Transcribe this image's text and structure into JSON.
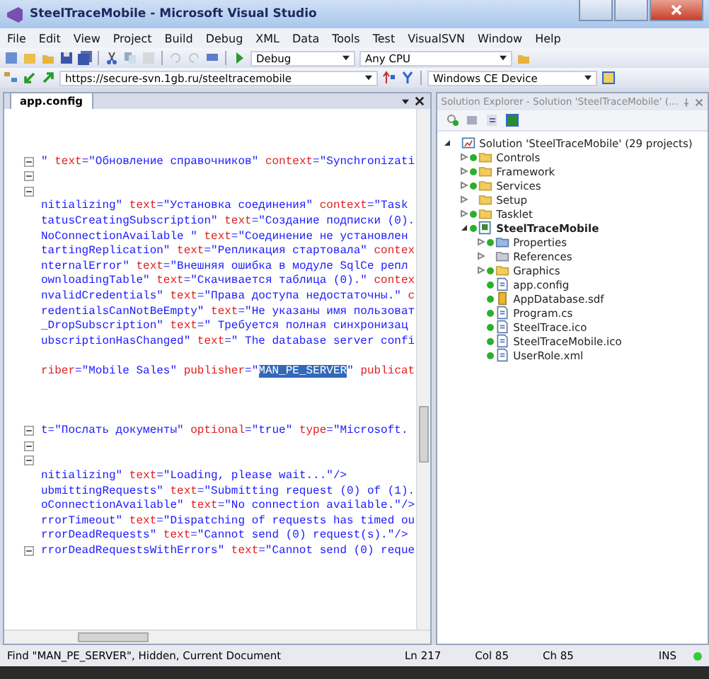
{
  "window": {
    "title": "SteelTraceMobile - Microsoft Visual Studio"
  },
  "menu": [
    "File",
    "Edit",
    "View",
    "Project",
    "Build",
    "Debug",
    "XML",
    "Data",
    "Tools",
    "Test",
    "VisualSVN",
    "Window",
    "Help"
  ],
  "toolbar": {
    "configuration": "Debug",
    "platform": "Any CPU",
    "repository_url": "https://secure-svn.1gb.ru/steeltracemobile",
    "device": "Windows CE Device"
  },
  "editor": {
    "tab": "app.config",
    "blocks": [
      [
        {
          "fold": true,
          "segments": [
            {
              "kind": "value",
              "text": "\" "
            },
            {
              "kind": "attr",
              "text": "text"
            },
            {
              "kind": "value",
              "text": "=\"Обновление справочников\" "
            },
            {
              "kind": "attr",
              "text": "context"
            },
            {
              "kind": "value",
              "text": "=\"Synchronizati"
            }
          ]
        },
        {
          "fold": true
        },
        {
          "fold": true
        },
        {
          "fold": false,
          "segments": [
            {
              "kind": "value",
              "text": "nitializing\" "
            },
            {
              "kind": "attr",
              "text": "text"
            },
            {
              "kind": "value",
              "text": "=\"Установка соединения\" "
            },
            {
              "kind": "attr",
              "text": "context"
            },
            {
              "kind": "value",
              "text": "=\"Task"
            }
          ]
        },
        {
          "fold": false,
          "segments": [
            {
              "kind": "value",
              "text": "tatusCreatingSubscription\" "
            },
            {
              "kind": "attr",
              "text": "text"
            },
            {
              "kind": "value",
              "text": "=\"Создание подписки (0)."
            }
          ]
        },
        {
          "fold": false,
          "segments": [
            {
              "kind": "value",
              "text": "NoConnectionAvailable \" "
            },
            {
              "kind": "attr",
              "text": "text"
            },
            {
              "kind": "value",
              "text": "=\"Соединение не установлен"
            }
          ]
        },
        {
          "fold": false,
          "segments": [
            {
              "kind": "value",
              "text": "tartingReplication\" "
            },
            {
              "kind": "attr",
              "text": "text"
            },
            {
              "kind": "value",
              "text": "=\"Репликация стартовала\" "
            },
            {
              "kind": "attr",
              "text": "contex"
            }
          ]
        },
        {
          "fold": false,
          "segments": [
            {
              "kind": "value",
              "text": "nternalError\" "
            },
            {
              "kind": "attr",
              "text": "text"
            },
            {
              "kind": "value",
              "text": "=\"Внешняя ошибка в модуле SqlCe репл"
            }
          ]
        },
        {
          "fold": false,
          "segments": [
            {
              "kind": "value",
              "text": "ownloadingTable\" "
            },
            {
              "kind": "attr",
              "text": "text"
            },
            {
              "kind": "value",
              "text": "=\"Скачивается таблица (0).\" "
            },
            {
              "kind": "attr",
              "text": "contex"
            }
          ]
        },
        {
          "fold": false,
          "segments": [
            {
              "kind": "value",
              "text": "nvalidCredentials\" "
            },
            {
              "kind": "attr",
              "text": "text"
            },
            {
              "kind": "value",
              "text": "=\"Права доступа недостаточны.\" "
            },
            {
              "kind": "attr",
              "text": "c"
            }
          ]
        },
        {
          "fold": false,
          "segments": [
            {
              "kind": "value",
              "text": "redentialsCanNotBeEmpty\" "
            },
            {
              "kind": "attr",
              "text": "text"
            },
            {
              "kind": "value",
              "text": "=\"Не указаны имя пользоват"
            }
          ]
        },
        {
          "fold": false,
          "segments": [
            {
              "kind": "value",
              "text": "_DropSubscription\" "
            },
            {
              "kind": "attr",
              "text": "text"
            },
            {
              "kind": "value",
              "text": "=\" Требуется полная синхронизац"
            }
          ]
        },
        {
          "fold": false,
          "segments": [
            {
              "kind": "value",
              "text": "ubscriptionHasChanged\" "
            },
            {
              "kind": "attr",
              "text": "text"
            },
            {
              "kind": "value",
              "text": "=\" The database server confi"
            }
          ]
        }
      ],
      [
        {
          "fold": false,
          "segments": [
            {
              "kind": "attr",
              "text": "riber"
            },
            {
              "kind": "value",
              "text": "=\"Mobile Sales\" "
            },
            {
              "kind": "attr",
              "text": "publisher"
            },
            {
              "kind": "value",
              "text": "=\""
            },
            {
              "kind": "selected",
              "text": "MAN_PE_SERVER"
            },
            {
              "kind": "value",
              "text": "\" "
            },
            {
              "kind": "attr",
              "text": "publicat"
            }
          ]
        }
      ],
      [
        {
          "fold": true,
          "segments": [
            {
              "kind": "value",
              "text": "t=\"Послать документы\" "
            },
            {
              "kind": "attr",
              "text": "optional"
            },
            {
              "kind": "value",
              "text": "=\"true\" "
            },
            {
              "kind": "attr",
              "text": "type"
            },
            {
              "kind": "value",
              "text": "=\"Microsoft."
            }
          ]
        },
        {
          "fold": true
        },
        {
          "fold": true
        },
        {
          "fold": false,
          "segments": [
            {
              "kind": "value",
              "text": "nitializing\" "
            },
            {
              "kind": "attr",
              "text": "text"
            },
            {
              "kind": "value",
              "text": "=\"Loading, please wait...\"/>"
            }
          ]
        },
        {
          "fold": false,
          "segments": [
            {
              "kind": "value",
              "text": "ubmittingRequests\" "
            },
            {
              "kind": "attr",
              "text": "text"
            },
            {
              "kind": "value",
              "text": "=\"Submitting request (0) of (1)."
            }
          ]
        },
        {
          "fold": false,
          "segments": [
            {
              "kind": "value",
              "text": "oConnectionAvailable\" "
            },
            {
              "kind": "attr",
              "text": "text"
            },
            {
              "kind": "value",
              "text": "=\"No connection available.\"/>"
            }
          ]
        },
        {
          "fold": false,
          "segments": [
            {
              "kind": "value",
              "text": "rrorTimeout\" "
            },
            {
              "kind": "attr",
              "text": "text"
            },
            {
              "kind": "value",
              "text": "=\"Dispatching of requests has timed ou"
            }
          ]
        },
        {
          "fold": false,
          "segments": [
            {
              "kind": "value",
              "text": "rrorDeadRequests\" "
            },
            {
              "kind": "attr",
              "text": "text"
            },
            {
              "kind": "value",
              "text": "=\"Cannot send (0) request(s).\"/>"
            }
          ]
        },
        {
          "fold": true,
          "segments": [
            {
              "kind": "value",
              "text": "rrorDeadRequestsWithErrors\" "
            },
            {
              "kind": "attr",
              "text": "text"
            },
            {
              "kind": "value",
              "text": "=\"Cannot send (0) reque"
            }
          ]
        }
      ]
    ]
  },
  "solution_explorer": {
    "title": "Solution Explorer - Solution 'SteelTraceMobile' (...",
    "tree": [
      {
        "label": "Solution 'SteelTraceMobile' (29 projects)",
        "kind": "solution",
        "expanded": true,
        "synced": false,
        "children": [
          {
            "label": "Controls",
            "kind": "folder",
            "expanded": false,
            "synced": true
          },
          {
            "label": "Framework",
            "kind": "folder",
            "expanded": false,
            "synced": true
          },
          {
            "label": "Services",
            "kind": "folder",
            "expanded": false,
            "synced": true
          },
          {
            "label": "Setup",
            "kind": "folder",
            "expanded": false,
            "synced": false
          },
          {
            "label": "Tasklet",
            "kind": "folder",
            "expanded": false,
            "synced": true
          },
          {
            "label": "SteelTraceMobile",
            "kind": "project",
            "expanded": true,
            "synced": true,
            "children": [
              {
                "label": "Properties",
                "kind": "properties",
                "expanded": false,
                "synced": true
              },
              {
                "label": "References",
                "kind": "references",
                "expanded": false,
                "synced": false
              },
              {
                "label": "Graphics",
                "kind": "folder",
                "expanded": false,
                "synced": true
              },
              {
                "label": "app.config",
                "kind": "file",
                "synced": true
              },
              {
                "label": "AppDatabase.sdf",
                "kind": "database",
                "synced": true
              },
              {
                "label": "Program.cs",
                "kind": "file",
                "synced": true
              },
              {
                "label": "SteelTrace.ico",
                "kind": "file",
                "synced": true
              },
              {
                "label": "SteelTraceMobile.ico",
                "kind": "file",
                "synced": true
              },
              {
                "label": "UserRole.xml",
                "kind": "file",
                "synced": true
              }
            ]
          }
        ]
      }
    ]
  },
  "status_bar": {
    "message": "Find \"MAN_PE_SERVER\", Hidden, Current Document",
    "line": "Ln 217",
    "column": "Col 85",
    "char": "Ch 85",
    "mode": "INS"
  }
}
